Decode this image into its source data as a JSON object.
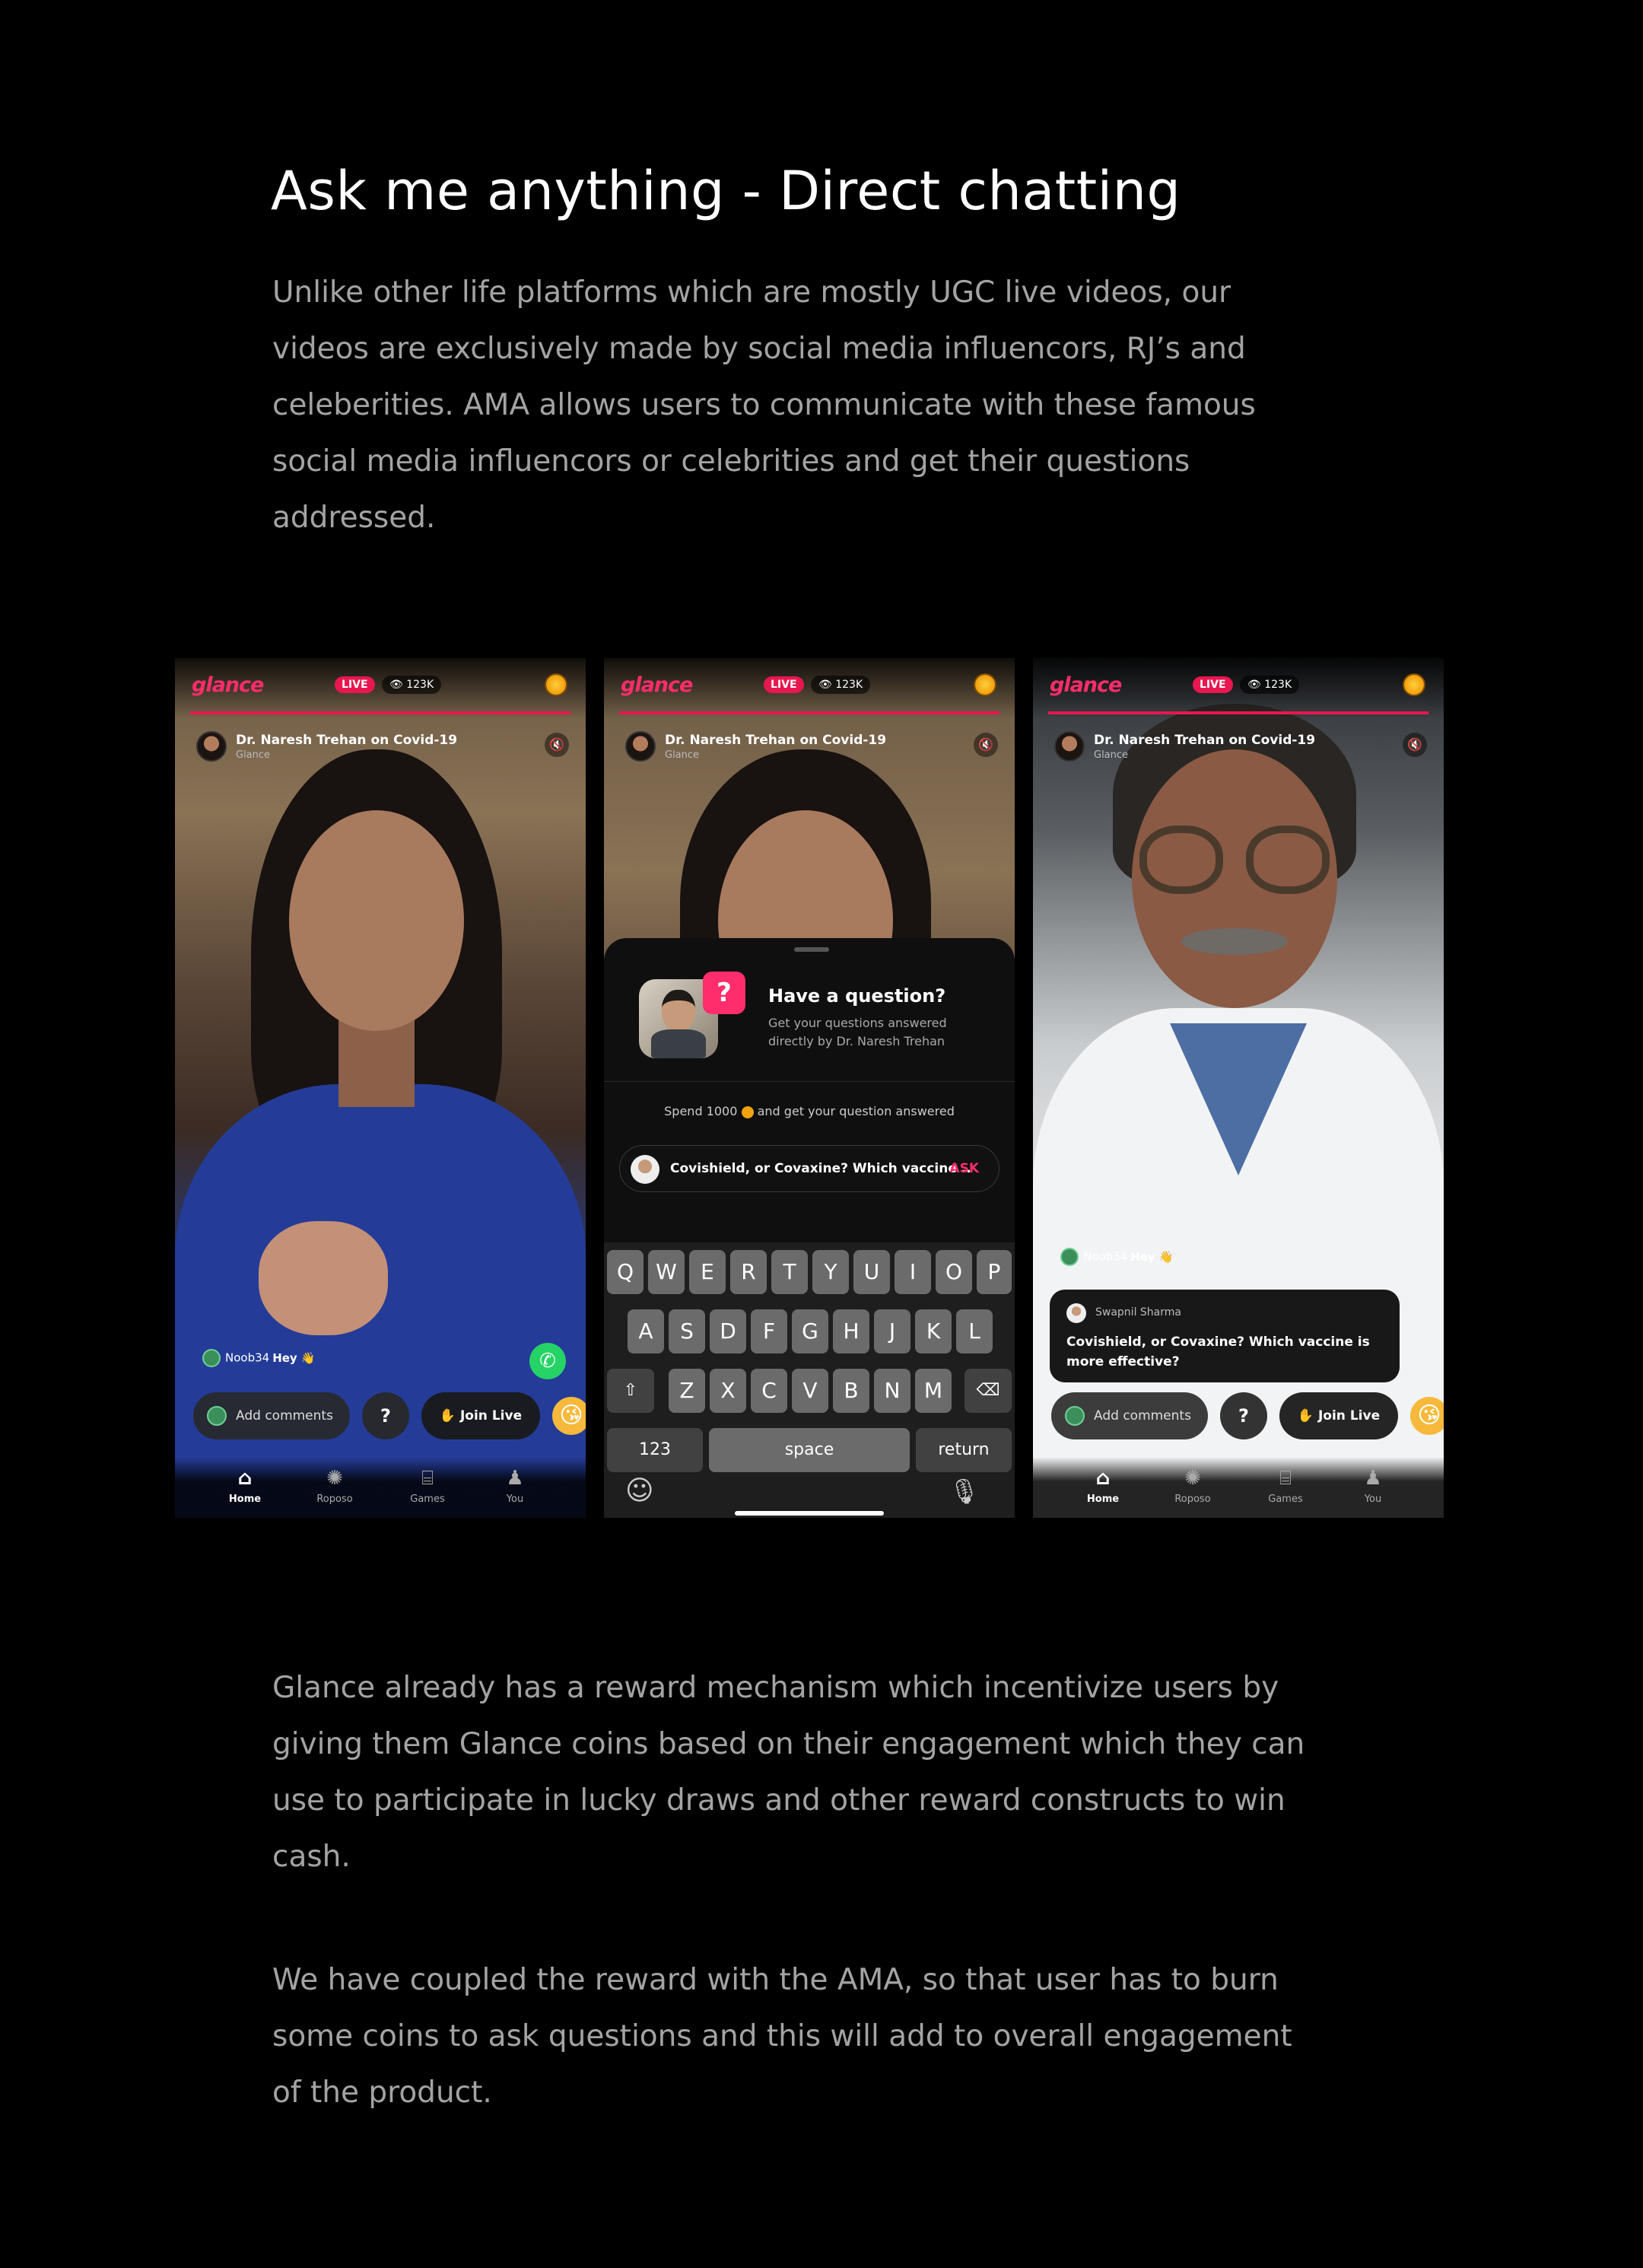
{
  "heading": "Ask me anything - Direct chatting",
  "intro": "Unlike other life platforms which are mostly UGC live videos, our videos are exclusively made by social media influencors, RJ’s and celeberities. AMA allows users to communicate with these famous social media influencors or celebrities and get their questions addressed.",
  "outro_1": "Glance already has a reward mechanism which incentivize users by giving them Glance coins based on their engagement which they can use to participate in lucky draws and other reward constructs to win cash.",
  "outro_2": "We have coupled the reward with the AMA, so that user has to burn some coins to ask questions and this will add to overall engagement of the product.",
  "app": {
    "logo": "glance",
    "live_label": "LIVE",
    "viewers": "👁 123K",
    "video_title": "Dr. Naresh Trehan on Covid-19",
    "video_channel": "Glance",
    "mute_icon": "🔇",
    "comment_user": "Noob34",
    "comment_text": "Hey 👋",
    "add_comments": "Add comments",
    "question_icon": "?",
    "join_live": "✋ Join Live",
    "reaction_emoji": "😘",
    "whatsapp_icon": "✆",
    "tabs": [
      {
        "label": "Home",
        "icon": "⌂"
      },
      {
        "label": "Roposo",
        "icon": "✺"
      },
      {
        "label": "Games",
        "icon": "⌸"
      },
      {
        "label": "You",
        "icon": "♟"
      }
    ]
  },
  "sheet": {
    "title": "Have a question?",
    "subtitle": "Get your questions answered directly by Dr. Naresh Trehan",
    "spend_prefix": "Spend 1000",
    "spend_suffix": "and get your question answered",
    "input_value": "Covishield, or Covaxine? Which vaccine ..",
    "ask_label": "ASK",
    "q_mark": "?"
  },
  "keyboard": {
    "row1": [
      "Q",
      "W",
      "E",
      "R",
      "T",
      "Y",
      "U",
      "I",
      "O",
      "P"
    ],
    "row2": [
      "A",
      "S",
      "D",
      "F",
      "G",
      "H",
      "J",
      "K",
      "L"
    ],
    "row3": [
      "Z",
      "X",
      "C",
      "V",
      "B",
      "N",
      "M"
    ],
    "shift": "⇧",
    "backspace": "⌫",
    "numbers": "123",
    "space": "space",
    "return": "return",
    "emoji": "☺",
    "mic": "🎙"
  },
  "question_card": {
    "user": "Swapnil Sharma",
    "text": "Covishield, or Covaxine? Which vaccine is more effective?"
  },
  "colors": {
    "brand": "#ff2d6b",
    "live": "#e8174f",
    "coin": "#f1a20f"
  }
}
